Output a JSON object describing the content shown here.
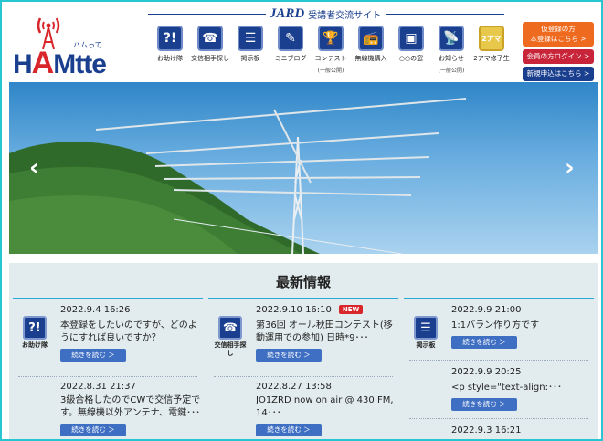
{
  "header": {
    "logo_text_h": "H",
    "logo_text_a": "A",
    "logo_text_rest": "Mtte",
    "logo_sub": "ハムって",
    "site_brand": "JARD",
    "site_title": "受講者交流サイト"
  },
  "nav": [
    {
      "label": "お助け隊",
      "glyph": "?!",
      "note": ""
    },
    {
      "label": "交信相手探し",
      "glyph": "☎",
      "note": ""
    },
    {
      "label": "掲示板",
      "glyph": "☰",
      "note": ""
    },
    {
      "label": "ミニブログ",
      "glyph": "✎",
      "note": ""
    },
    {
      "label": "コンテスト",
      "glyph": "🏆",
      "note": "(一般公開)"
    },
    {
      "label": "無線機購入",
      "glyph": "📻",
      "note": ""
    },
    {
      "label": "○○の窓",
      "glyph": "▣",
      "note": ""
    },
    {
      "label": "お知らせ",
      "glyph": "📡",
      "note": "(一般公開)"
    },
    {
      "label": "2アマ修了生",
      "glyph": "2アマ",
      "note": ""
    }
  ],
  "side_buttons": {
    "provisional_line1": "仮登録の方",
    "provisional_line2": "本登録はこちら >",
    "member_login": "会員の方ログイン >",
    "new_apply": "新規申込はこちら >"
  },
  "hero": {
    "prev_arrow": "‹",
    "next_arrow": "›"
  },
  "news": {
    "title": "最新情報",
    "read_more": "続きを読む ＞",
    "new_badge": "NEW",
    "columns": [
      {
        "icon_label": "お助け隊",
        "icon_glyph": "?!",
        "entries": [
          {
            "date": "2022.9.4 16:26",
            "text": "本登録をしたいのですが、どのようにすれば良いですか？"
          },
          {
            "date": "2022.8.31 21:37",
            "text": "3級合格したのでCWで交信予定です。無線機以外アンテナ、電鍵･･･"
          }
        ]
      },
      {
        "icon_label": "交信相手探し",
        "icon_glyph": "☎",
        "entries": [
          {
            "date": "2022.9.10 16:10",
            "text": "第36回 オール秋田コンテスト(移動運用での参加) 日時*9･･･",
            "is_new": true
          },
          {
            "date": "2022.8.27 13:58",
            "text": "JO1ZRD now on air @ 430 FM, 14･･･"
          }
        ]
      },
      {
        "icon_label": "掲示板",
        "icon_glyph": "☰",
        "entries": [
          {
            "date": "2022.9.9 21:00",
            "text": "1:1バラン作り方です"
          },
          {
            "date": "2022.9.9 20:25",
            "text": "<p style=\"text-align:･･･"
          },
          {
            "date": "2022.9.3 16:21",
            "text": ""
          }
        ]
      }
    ]
  },
  "colors": {
    "brand_navy": "#1a3f8f",
    "accent_red": "#d8262b",
    "frame_cyan": "#27c6d0",
    "news_bg": "#e2ecee",
    "button_blue": "#3f6fc3"
  }
}
